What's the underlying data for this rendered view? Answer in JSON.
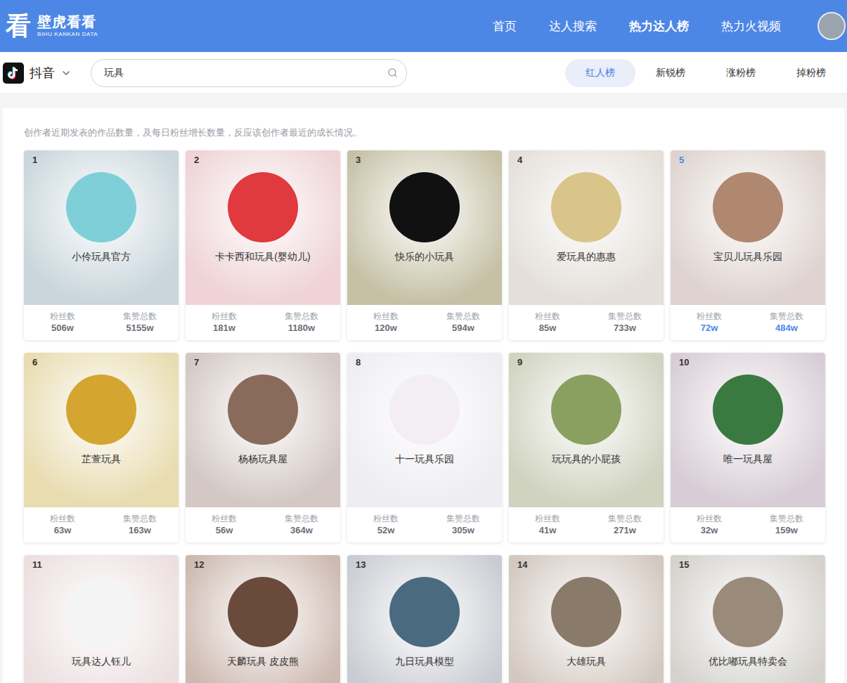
{
  "header": {
    "logo_mark": "看",
    "logo_title": "壁虎看看",
    "logo_subtitle": "BIHU KANKAN DATA",
    "nav": [
      {
        "label": "首页",
        "selected": false
      },
      {
        "label": "达人搜索",
        "selected": false
      },
      {
        "label": "热力达人榜",
        "selected": true
      },
      {
        "label": "热力火视频",
        "selected": false
      }
    ]
  },
  "toolbar": {
    "platform": "抖音",
    "search": {
      "value": "玩具"
    },
    "tabs": [
      {
        "label": "红人榜",
        "selected": true
      },
      {
        "label": "新锐榜",
        "selected": false
      },
      {
        "label": "涨粉榜",
        "selected": false
      },
      {
        "label": "掉粉榜",
        "selected": false
      }
    ]
  },
  "description": "创作者近期发表的作品数量，及每日粉丝增长数量，反应该创作者最近的成长情况。",
  "stat_labels": {
    "fans": "粉丝数",
    "likes": "集赞总数"
  },
  "cards": [
    {
      "rank": "1",
      "name": "小伶玩具官方",
      "fans": "506w",
      "likes": "5155w",
      "selected": false,
      "color": "#c9d6dc",
      "avatar_color": "#7ecfd8"
    },
    {
      "rank": "2",
      "name": "卡卡西和玩具(婴幼儿)",
      "fans": "181w",
      "likes": "1180w",
      "selected": false,
      "color": "#efd3d6",
      "avatar_color": "#e0393e"
    },
    {
      "rank": "3",
      "name": "快乐的小玩具",
      "fans": "120w",
      "likes": "594w",
      "selected": false,
      "color": "#c6c1a6",
      "avatar_color": "#111111"
    },
    {
      "rank": "4",
      "name": "爱玩具的惠惠",
      "fans": "85w",
      "likes": "733w",
      "selected": false,
      "color": "#e4dfd8",
      "avatar_color": "#d9c48a"
    },
    {
      "rank": "5",
      "name": "宝贝儿玩具乐园",
      "fans": "72w",
      "likes": "484w",
      "selected": true,
      "color": "#ded3ce",
      "avatar_color": "#b08870"
    },
    {
      "rank": "6",
      "name": "芷萱玩具",
      "fans": "63w",
      "likes": "163w",
      "selected": false,
      "color": "#e8dcb0",
      "avatar_color": "#d4a530"
    },
    {
      "rank": "7",
      "name": "杨杨玩具屋",
      "fans": "56w",
      "likes": "364w",
      "selected": false,
      "color": "#d3c8c3",
      "avatar_color": "#8a6a5a"
    },
    {
      "rank": "8",
      "name": "十一玩具乐园",
      "fans": "52w",
      "likes": "305w",
      "selected": false,
      "color": "#eeedf1",
      "avatar_color": "#f2eef4"
    },
    {
      "rank": "9",
      "name": "玩玩具的小屁孩",
      "fans": "41w",
      "likes": "271w",
      "selected": false,
      "color": "#d0d3c0",
      "avatar_color": "#8aa060"
    },
    {
      "rank": "10",
      "name": "唯一玩具屋",
      "fans": "32w",
      "likes": "159w",
      "selected": false,
      "color": "#d8cdd6",
      "avatar_color": "#3a7a40"
    },
    {
      "rank": "11",
      "name": "玩具达人钰儿",
      "selected": false,
      "color": "#ecdfe0",
      "avatar_color": "#f4f4f4"
    },
    {
      "rank": "12",
      "name": "天麟玩具 皮皮熊",
      "selected": false,
      "color": "#cdb9b0",
      "avatar_color": "#6a4a3a"
    },
    {
      "rank": "13",
      "name": "九日玩具模型",
      "selected": false,
      "color": "#c9ccd2",
      "avatar_color": "#4a6a80"
    },
    {
      "rank": "14",
      "name": "大雄玩具",
      "selected": false,
      "color": "#d3c8c0",
      "avatar_color": "#8a7a6a"
    },
    {
      "rank": "15",
      "name": "优比嘟玩具特卖会",
      "selected": false,
      "color": "#d5d2cd",
      "avatar_color": "#9a8a7a"
    }
  ]
}
